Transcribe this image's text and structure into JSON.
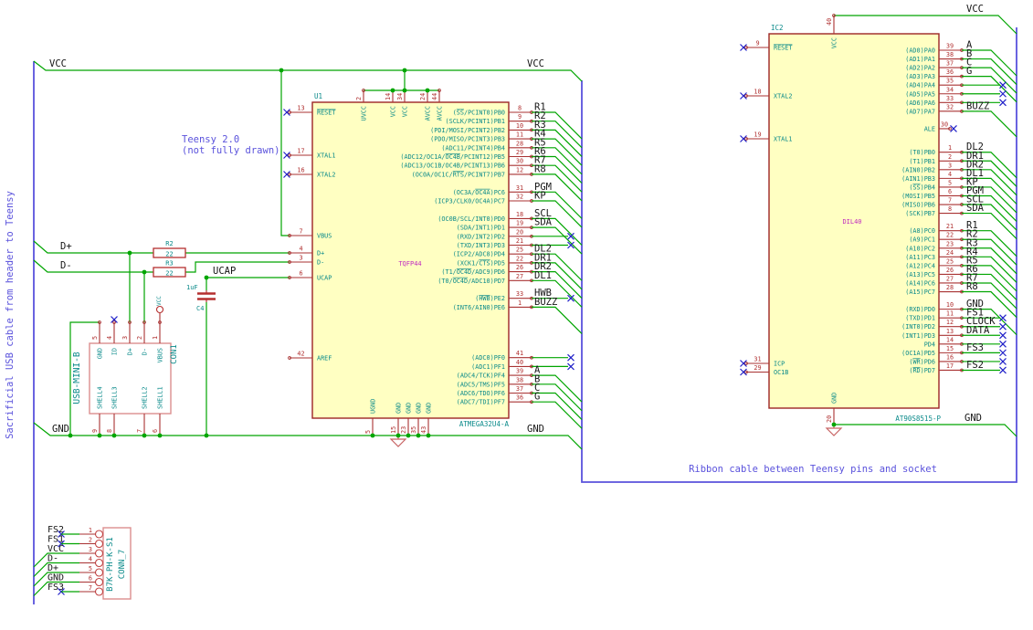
{
  "colors": {
    "wire": "#00a500",
    "pin": "#a83232",
    "pin_number": "#b03030",
    "pin_name": "#0a8a8a",
    "body_outline": "#9c2424",
    "body_fill": "#ffffc2",
    "net_label": "#161616",
    "note_blue": "#5a52dc",
    "no_connect": "#2020c8",
    "field_magenta": "#c02bc0",
    "device_red": "#b52f2f",
    "connector_outline": "#dc8e8e",
    "ground_symbol": "#c86464"
  },
  "notes": {
    "sacrificial": "Sacrificial USB cable from header to Teensy",
    "teensy_1": "Teensy 2.0",
    "teensy_2": "(not fully drawn)",
    "ribbon": "Ribbon cable between Teensy pins and socket"
  },
  "net_labels": {
    "vcc_left": "VCC",
    "vcc_right": "VCC",
    "gnd_left": "GND",
    "gnd_right": "GND",
    "dplus": "D+",
    "dminus": "D-",
    "ucap": "UCAP",
    "ic2_vcc": "VCC",
    "ic2_gnd": "GND"
  },
  "u1": {
    "refdes": "U1",
    "value": "ATMEGA32U4-A",
    "footprint": "TQFP44",
    "top_pins": [
      {
        "num": "2",
        "name": "UVCC"
      },
      {
        "num": "14",
        "name": "VCC"
      },
      {
        "num": "34",
        "name": "VCC"
      },
      {
        "num": "24",
        "name": "AVCC"
      },
      {
        "num": "44",
        "name": "AVCC"
      }
    ],
    "bottom_pins": [
      {
        "num": "5",
        "name": "UGND"
      },
      {
        "num": "15",
        "name": "GND"
      },
      {
        "num": "23",
        "name": "GND"
      },
      {
        "num": "35",
        "name": "GND"
      },
      {
        "num": "43",
        "name": "GND"
      }
    ],
    "left_pins": [
      {
        "num": "13",
        "name": "|RESET|",
        "nc": true
      },
      {
        "num": "17",
        "name": "XTAL1",
        "nc": true
      },
      {
        "num": "16",
        "name": "XTAL2",
        "nc": true
      },
      {
        "num": "7",
        "name": "VBUS"
      },
      {
        "num": "4",
        "name": "D+"
      },
      {
        "num": "3",
        "name": "D-"
      },
      {
        "num": "6",
        "name": "UCAP"
      },
      {
        "num": "42",
        "name": "AREF"
      }
    ],
    "right_pins": [
      {
        "num": "8",
        "name": "(|SS|/PCINT0)PB0",
        "net": "R1"
      },
      {
        "num": "9",
        "name": "(SCLK/PCINT1)PB1",
        "net": "R2"
      },
      {
        "num": "10",
        "name": "(PDI/MOSI/PCINT2)PB2",
        "net": "R3"
      },
      {
        "num": "11",
        "name": "(PDO/MISO/PCINT3)PB3",
        "net": "R4"
      },
      {
        "num": "28",
        "name": "(ADC11/PCINT4)PB4",
        "net": "R5"
      },
      {
        "num": "29",
        "name": "(ADC12/OC1A/|OC4B|/PCINT12)PB5",
        "net": "R6"
      },
      {
        "num": "30",
        "name": "(ADC13/OC1B/OC4B/PCINT13)PB6",
        "net": "R7"
      },
      {
        "num": "12",
        "name": "(OC0A/OC1C/|RTS|/PCINT7)PB7",
        "net": "R8"
      },
      {
        "num": "31",
        "name": "(OC3A/|OC4A|)PC6",
        "net": "PGM"
      },
      {
        "num": "32",
        "name": "(ICP3/CLK0/OC4A)PC7",
        "net": "KP"
      },
      {
        "num": "18",
        "name": "(OC0B/SCL/INT0)PD0",
        "net": "SCL"
      },
      {
        "num": "19",
        "name": "(SDA/INT1)PD1",
        "net": "SDA"
      },
      {
        "num": "20",
        "name": "(RXD/INT2)PD2",
        "nc": true
      },
      {
        "num": "21",
        "name": "(TXD/INT3)PD3",
        "nc": true
      },
      {
        "num": "25",
        "name": "(ICP2/ADC8)PD4",
        "net": "DL2"
      },
      {
        "num": "22",
        "name": "(XCK1/|CTS|)PD5",
        "net": "DR1"
      },
      {
        "num": "26",
        "name": "(T1/|OC4D|/ADC9)PD6",
        "net": "DR2"
      },
      {
        "num": "27",
        "name": "(T0/|OC4D|/ADC10)PD7",
        "net": "DL1"
      },
      {
        "num": "33",
        "name": "(|HWB|)PE2",
        "net": "HWB",
        "nc": true
      },
      {
        "num": "1",
        "name": "(INT6/AIN0)PE6",
        "net": "BUZZ"
      },
      {
        "num": "41",
        "name": "(ADC0)PF0",
        "nc": true
      },
      {
        "num": "40",
        "name": "(ADC1)PF1",
        "nc": true
      },
      {
        "num": "39",
        "name": "(ADC4/TCK)PF4",
        "net": "A"
      },
      {
        "num": "38",
        "name": "(ADC5/TMS)PF5",
        "net": "B"
      },
      {
        "num": "37",
        "name": "(ADC6/TDO)PF6",
        "net": "C"
      },
      {
        "num": "36",
        "name": "(ADC7/TDI)PF7",
        "net": "G"
      }
    ]
  },
  "ic2": {
    "refdes": "IC2",
    "value": "AT90S8515-P",
    "footprint": "DIL40",
    "top_pins": [
      {
        "num": "40",
        "name": "VCC"
      }
    ],
    "bottom_pins": [
      {
        "num": "20",
        "name": "GND"
      }
    ],
    "left_pins": [
      {
        "num": "9",
        "name": "|RESET|",
        "nc": true
      },
      {
        "num": "18",
        "name": "XTAL2",
        "nc": true
      },
      {
        "num": "19",
        "name": "XTAL1",
        "nc": true
      },
      {
        "num": "31",
        "name": "ICP",
        "nc": true
      },
      {
        "num": "29",
        "name": "OC1B",
        "nc": true
      }
    ],
    "right_pins": [
      {
        "num": "39",
        "name": "(AD0)PA0",
        "net": "A"
      },
      {
        "num": "38",
        "name": "(AD1)PA1",
        "net": "B"
      },
      {
        "num": "37",
        "name": "(AD2)PA2",
        "net": "C"
      },
      {
        "num": "36",
        "name": "(AD3)PA3",
        "net": "G"
      },
      {
        "num": "35",
        "name": "(AD4)PA4",
        "nc": true
      },
      {
        "num": "34",
        "name": "(AD5)PA5",
        "nc": true
      },
      {
        "num": "33",
        "name": "(AD6)PA6",
        "nc": true
      },
      {
        "num": "32",
        "name": "(AD7)PA7",
        "net": "BUZZ"
      },
      {
        "num": "30",
        "name": "ALE",
        "nc": true,
        "short": true
      },
      {
        "num": "1",
        "name": "(T0)PB0",
        "net": "DL2"
      },
      {
        "num": "2",
        "name": "(T1)PB1",
        "net": "DR1"
      },
      {
        "num": "3",
        "name": "(AIN0)PB2",
        "net": "DR2"
      },
      {
        "num": "4",
        "name": "(AIN1)PB3",
        "net": "DL1"
      },
      {
        "num": "5",
        "name": "(|SS|)PB4",
        "net": "KP"
      },
      {
        "num": "6",
        "name": "(MOSI)PB5",
        "net": "PGM"
      },
      {
        "num": "7",
        "name": "(MISO)PB6",
        "net": "SCL"
      },
      {
        "num": "8",
        "name": "(SCK)PB7",
        "net": "SDA"
      },
      {
        "num": "21",
        "name": "(A8)PC0",
        "net": "R1"
      },
      {
        "num": "22",
        "name": "(A9)PC1",
        "net": "R2"
      },
      {
        "num": "23",
        "name": "(A10)PC2",
        "net": "R3"
      },
      {
        "num": "24",
        "name": "(A11)PC3",
        "net": "R4"
      },
      {
        "num": "25",
        "name": "(A12)PC4",
        "net": "R5"
      },
      {
        "num": "26",
        "name": "(A13)PC5",
        "net": "R6"
      },
      {
        "num": "27",
        "name": "(A14)PC6",
        "net": "R7"
      },
      {
        "num": "28",
        "name": "(A15)PC7",
        "net": "R8"
      },
      {
        "num": "10",
        "name": "(RXD)PD0",
        "net": "GND"
      },
      {
        "num": "11",
        "name": "(TXD)PD1",
        "net": "FS1",
        "nc": true
      },
      {
        "num": "12",
        "name": "(INT0)PD2",
        "net": "CLOCK",
        "nc": true
      },
      {
        "num": "13",
        "name": "(INT1)PD3",
        "net": "DATA",
        "nc": true
      },
      {
        "num": "14",
        "name": "PD4",
        "nc": true
      },
      {
        "num": "15",
        "name": "(OC1A)PD5",
        "net": "FS3",
        "nc": true
      },
      {
        "num": "16",
        "name": "(|WR|)PD6",
        "nc": true
      },
      {
        "num": "17",
        "name": "(|RD|)PD7",
        "net": "FS2",
        "nc": true
      }
    ]
  },
  "con1": {
    "refdes": "CON1",
    "value": "USB-MINI-B",
    "power_flag": "VCC",
    "top_pins": [
      {
        "num": "5",
        "name": "GND"
      },
      {
        "num": "4",
        "name": "ID",
        "nc": true
      },
      {
        "num": "3",
        "name": "D+"
      },
      {
        "num": "2",
        "name": "D-"
      },
      {
        "num": "1",
        "name": "VBUS",
        "vcc": true
      }
    ],
    "bottom_pins": [
      {
        "num": "9",
        "name": "SHELL4"
      },
      {
        "num": "8",
        "name": "SHELL3"
      },
      {
        "num": "7",
        "name": "SHELL2"
      },
      {
        "num": "6",
        "name": "SHELL1"
      }
    ]
  },
  "conn7": {
    "refdes": "CONN_7",
    "value": "B7K-PH-K-S1",
    "pins": [
      {
        "num": "1",
        "net": "FS2",
        "nc": true
      },
      {
        "num": "2",
        "net": "FS1",
        "nc": true
      },
      {
        "num": "3",
        "net": "VCC"
      },
      {
        "num": "4",
        "net": "D-"
      },
      {
        "num": "5",
        "net": "D+"
      },
      {
        "num": "6",
        "net": "GND"
      },
      {
        "num": "7",
        "net": "FS3",
        "nc": true
      }
    ]
  },
  "r2": {
    "refdes": "R2",
    "value": "22"
  },
  "r3": {
    "refdes": "R3",
    "value": "22"
  },
  "c4": {
    "refdes": "C4",
    "value": "1uF"
  }
}
